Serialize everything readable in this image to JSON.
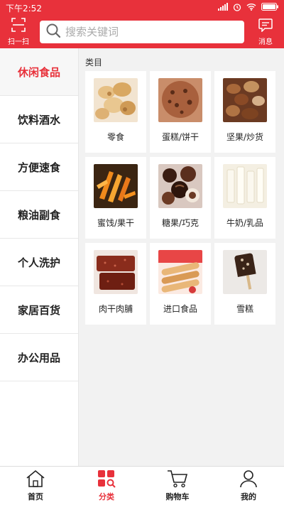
{
  "status_bar": {
    "time": "下午2:52",
    "icons": [
      "signal-icon",
      "alarm-icon",
      "wifi-icon",
      "battery-icon"
    ]
  },
  "header": {
    "scan_label": "扫一扫",
    "search_placeholder": "搜索关键词",
    "message_label": "消息",
    "accent_color": "#e8313b"
  },
  "sidebar": {
    "items": [
      {
        "label": "休闲食品",
        "active": true
      },
      {
        "label": "饮料酒水"
      },
      {
        "label": "方便速食"
      },
      {
        "label": "粮油副食"
      },
      {
        "label": "个人洗护"
      },
      {
        "label": "家居百货"
      },
      {
        "label": "办公用品"
      }
    ]
  },
  "main": {
    "section_title": "类目",
    "categories": [
      {
        "label": "零食",
        "icon": "snack-image"
      },
      {
        "label": "蛋糕/饼干",
        "icon": "cookie-image"
      },
      {
        "label": "坚果/炒货",
        "icon": "nuts-image"
      },
      {
        "label": "蜜饯/果干",
        "icon": "dried-fruit-image"
      },
      {
        "label": "糖果/巧克",
        "icon": "chocolate-image"
      },
      {
        "label": "牛奶/乳品",
        "icon": "milk-image"
      },
      {
        "label": "肉干肉脯",
        "icon": "jerky-image"
      },
      {
        "label": "进口食品",
        "icon": "imported-wafer-image"
      },
      {
        "label": "雪糕",
        "icon": "ice-cream-image"
      }
    ]
  },
  "tabbar": {
    "tabs": [
      {
        "label": "首页",
        "icon": "home-icon"
      },
      {
        "label": "分类",
        "icon": "category-icon",
        "active": true
      },
      {
        "label": "购物车",
        "icon": "cart-icon"
      },
      {
        "label": "我的",
        "icon": "profile-icon"
      }
    ]
  }
}
